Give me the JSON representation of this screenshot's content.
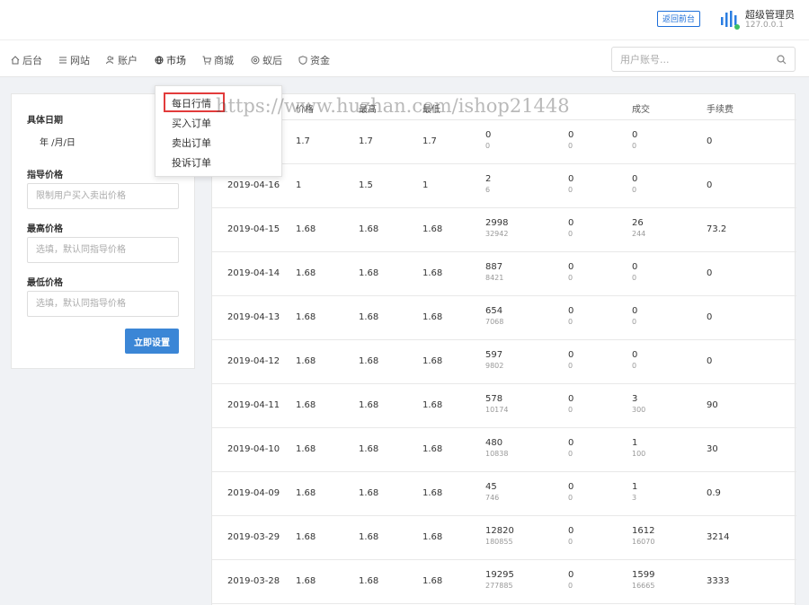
{
  "header": {
    "back_button": "返回前台",
    "admin_name": "超级管理员",
    "admin_ip": "127.0.0.1"
  },
  "nav": {
    "items": [
      {
        "label": "后台",
        "icon": "home-icon"
      },
      {
        "label": "网站",
        "icon": "list-icon"
      },
      {
        "label": "账户",
        "icon": "users-icon"
      },
      {
        "label": "市场",
        "icon": "globe-icon"
      },
      {
        "label": "商城",
        "icon": "cart-icon"
      },
      {
        "label": "蚁后",
        "icon": "gear-icon"
      },
      {
        "label": "资金",
        "icon": "shield-icon"
      }
    ],
    "search_placeholder": "用户账号..."
  },
  "dropdown": {
    "items": [
      "每日行情",
      "买入订单",
      "卖出订单",
      "投诉订单"
    ],
    "selected": "每日行情"
  },
  "form": {
    "date_label": "具体日期",
    "date_value": "年 /月/日",
    "guide_label": "指导价格",
    "guide_placeholder": "限制用户买入卖出价格",
    "max_label": "最高价格",
    "max_placeholder": "选填，默认同指导价格",
    "min_label": "最低价格",
    "min_placeholder": "选填，默认同指导价格",
    "submit": "立即设置"
  },
  "table": {
    "headers": [
      "",
      "价格",
      "最高",
      "最低",
      "",
      "",
      "成交",
      "手续费"
    ],
    "rows": [
      {
        "date": "",
        "price": "1.7",
        "high": "1.7",
        "low": "1.7",
        "c1": "0",
        "c1s": "0",
        "c2": "0",
        "c2s": "0",
        "c3": "0",
        "c3s": "0",
        "fee": "0"
      },
      {
        "date": "2019-04-16",
        "price": "1",
        "high": "1.5",
        "low": "1",
        "c1": "2",
        "c1s": "6",
        "c2": "0",
        "c2s": "0",
        "c3": "0",
        "c3s": "0",
        "fee": "0"
      },
      {
        "date": "2019-04-15",
        "price": "1.68",
        "high": "1.68",
        "low": "1.68",
        "c1": "2998",
        "c1s": "32942",
        "c2": "0",
        "c2s": "0",
        "c3": "26",
        "c3s": "244",
        "fee": "73.2"
      },
      {
        "date": "2019-04-14",
        "price": "1.68",
        "high": "1.68",
        "low": "1.68",
        "c1": "887",
        "c1s": "8421",
        "c2": "0",
        "c2s": "0",
        "c3": "0",
        "c3s": "0",
        "fee": "0"
      },
      {
        "date": "2019-04-13",
        "price": "1.68",
        "high": "1.68",
        "low": "1.68",
        "c1": "654",
        "c1s": "7068",
        "c2": "0",
        "c2s": "0",
        "c3": "0",
        "c3s": "0",
        "fee": "0"
      },
      {
        "date": "2019-04-12",
        "price": "1.68",
        "high": "1.68",
        "low": "1.68",
        "c1": "597",
        "c1s": "9802",
        "c2": "0",
        "c2s": "0",
        "c3": "0",
        "c3s": "0",
        "fee": "0"
      },
      {
        "date": "2019-04-11",
        "price": "1.68",
        "high": "1.68",
        "low": "1.68",
        "c1": "578",
        "c1s": "10174",
        "c2": "0",
        "c2s": "0",
        "c3": "3",
        "c3s": "300",
        "fee": "90"
      },
      {
        "date": "2019-04-10",
        "price": "1.68",
        "high": "1.68",
        "low": "1.68",
        "c1": "480",
        "c1s": "10838",
        "c2": "0",
        "c2s": "0",
        "c3": "1",
        "c3s": "100",
        "fee": "30"
      },
      {
        "date": "2019-04-09",
        "price": "1.68",
        "high": "1.68",
        "low": "1.68",
        "c1": "45",
        "c1s": "746",
        "c2": "0",
        "c2s": "0",
        "c3": "1",
        "c3s": "3",
        "fee": "0.9"
      },
      {
        "date": "2019-03-29",
        "price": "1.68",
        "high": "1.68",
        "low": "1.68",
        "c1": "12820",
        "c1s": "180855",
        "c2": "0",
        "c2s": "0",
        "c3": "1612",
        "c3s": "16070",
        "fee": "3214"
      },
      {
        "date": "2019-03-28",
        "price": "1.68",
        "high": "1.68",
        "low": "1.68",
        "c1": "19295",
        "c1s": "277885",
        "c2": "0",
        "c2s": "0",
        "c3": "1599",
        "c3s": "16665",
        "fee": "3333"
      }
    ]
  },
  "watermark": "https://www.huzhan.com/ishop21448"
}
